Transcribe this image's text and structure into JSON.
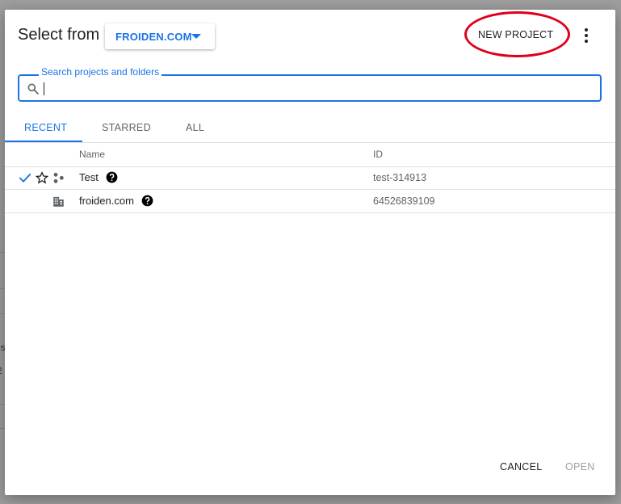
{
  "dialog": {
    "title": "Select from",
    "organization": "FROIDEN.COM",
    "new_project_label": "NEW PROJECT",
    "search": {
      "label": "Search projects and folders",
      "value": ""
    },
    "tabs": [
      {
        "label": "RECENT",
        "active": true
      },
      {
        "label": "STARRED",
        "active": false
      },
      {
        "label": "ALL",
        "active": false
      }
    ],
    "table": {
      "columns": [
        "Name",
        "ID"
      ],
      "rows": [
        {
          "name": "Test",
          "id": "test-314913",
          "selected": true,
          "starred": false,
          "type_icon": "project-icon"
        },
        {
          "name": "froiden.com",
          "id": "64526839109",
          "selected": false,
          "starred": false,
          "type_icon": "organization-icon"
        }
      ]
    },
    "footer": {
      "cancel_label": "CANCEL",
      "open_label": "OPEN"
    }
  },
  "background_fragments": [
    "es",
    "2"
  ],
  "colors": {
    "accent": "#1a73e8",
    "highlight": "#e0001b",
    "overlay": "#9e9e9e",
    "disabled": "#9aa0a6"
  }
}
